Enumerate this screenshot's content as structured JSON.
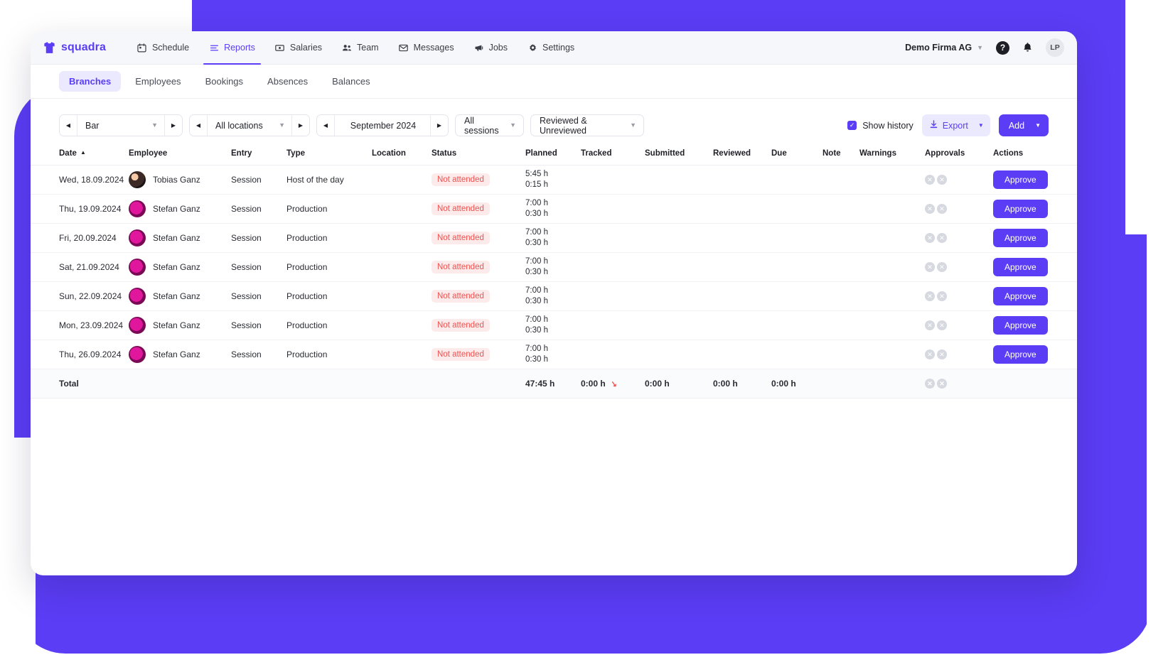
{
  "brand": {
    "name": "squadra",
    "icon": "tshirt-icon"
  },
  "topnav": {
    "items": [
      {
        "label": "Schedule",
        "icon": "calendar-icon",
        "active": false
      },
      {
        "label": "Reports",
        "icon": "list-icon",
        "active": true
      },
      {
        "label": "Salaries",
        "icon": "money-icon",
        "active": false
      },
      {
        "label": "Team",
        "icon": "people-icon",
        "active": false
      },
      {
        "label": "Messages",
        "icon": "envelope-icon",
        "active": false
      },
      {
        "label": "Jobs",
        "icon": "megaphone-icon",
        "active": false
      },
      {
        "label": "Settings",
        "icon": "gear-icon",
        "active": false
      }
    ],
    "company": "Demo Firma AG",
    "help_icon": "question-mark-icon",
    "bell_icon": "bell-icon",
    "avatar_initials": "LP"
  },
  "subtabs": [
    {
      "label": "Branches",
      "active": true
    },
    {
      "label": "Employees",
      "active": false
    },
    {
      "label": "Bookings",
      "active": false
    },
    {
      "label": "Absences",
      "active": false
    },
    {
      "label": "Balances",
      "active": false
    }
  ],
  "toolbar": {
    "branch_value": "Bar",
    "location_value": "All locations",
    "month_value": "September 2024",
    "sessions_value": "All sessions",
    "review_value": "Reviewed & Unreviewed",
    "show_history_label": "Show history",
    "show_history_checked": true,
    "export_label": "Export",
    "export_icon": "download-icon",
    "add_label": "Add"
  },
  "table": {
    "columns": [
      "Date",
      "Employee",
      "Entry",
      "Type",
      "Location",
      "Status",
      "Planned",
      "Tracked",
      "Submitted",
      "Reviewed",
      "Due",
      "Note",
      "Warnings",
      "Approvals",
      "Actions"
    ],
    "sort_column": "Date",
    "sort_direction": "asc",
    "rows": [
      {
        "date": "Wed, 18.09.2024",
        "employee": "Tobias Ganz",
        "avatar": "av-a",
        "entry": "Session",
        "type": "Host of the day",
        "location": "",
        "status": "Not attended",
        "planned_a": "5:45 h",
        "planned_b": "0:15 h",
        "tracked": "",
        "submitted": "",
        "reviewed": "",
        "due": "",
        "note": "",
        "warnings": "",
        "action": "Approve"
      },
      {
        "date": "Thu, 19.09.2024",
        "employee": "Stefan Ganz",
        "avatar": "av-b",
        "entry": "Session",
        "type": "Production",
        "location": "",
        "status": "Not attended",
        "planned_a": "7:00 h",
        "planned_b": "0:30 h",
        "tracked": "",
        "submitted": "",
        "reviewed": "",
        "due": "",
        "note": "",
        "warnings": "",
        "action": "Approve"
      },
      {
        "date": "Fri, 20.09.2024",
        "employee": "Stefan Ganz",
        "avatar": "av-b",
        "entry": "Session",
        "type": "Production",
        "location": "",
        "status": "Not attended",
        "planned_a": "7:00 h",
        "planned_b": "0:30 h",
        "tracked": "",
        "submitted": "",
        "reviewed": "",
        "due": "",
        "note": "",
        "warnings": "",
        "action": "Approve"
      },
      {
        "date": "Sat, 21.09.2024",
        "employee": "Stefan Ganz",
        "avatar": "av-b",
        "entry": "Session",
        "type": "Production",
        "location": "",
        "status": "Not attended",
        "planned_a": "7:00 h",
        "planned_b": "0:30 h",
        "tracked": "",
        "submitted": "",
        "reviewed": "",
        "due": "",
        "note": "",
        "warnings": "",
        "action": "Approve"
      },
      {
        "date": "Sun, 22.09.2024",
        "employee": "Stefan Ganz",
        "avatar": "av-b",
        "entry": "Session",
        "type": "Production",
        "location": "",
        "status": "Not attended",
        "planned_a": "7:00 h",
        "planned_b": "0:30 h",
        "tracked": "",
        "submitted": "",
        "reviewed": "",
        "due": "",
        "note": "",
        "warnings": "",
        "action": "Approve"
      },
      {
        "date": "Mon, 23.09.2024",
        "employee": "Stefan Ganz",
        "avatar": "av-b",
        "entry": "Session",
        "type": "Production",
        "location": "",
        "status": "Not attended",
        "planned_a": "7:00 h",
        "planned_b": "0:30 h",
        "tracked": "",
        "submitted": "",
        "reviewed": "",
        "due": "",
        "note": "",
        "warnings": "",
        "action": "Approve"
      },
      {
        "date": "Thu, 26.09.2024",
        "employee": "Stefan Ganz",
        "avatar": "av-b",
        "entry": "Session",
        "type": "Production",
        "location": "",
        "status": "Not attended",
        "planned_a": "7:00 h",
        "planned_b": "0:30 h",
        "tracked": "",
        "submitted": "",
        "reviewed": "",
        "due": "",
        "note": "",
        "warnings": "",
        "action": "Approve"
      }
    ],
    "total": {
      "label": "Total",
      "planned": "47:45 h",
      "tracked": "0:00 h",
      "submitted": "0:00 h",
      "reviewed": "0:00 h",
      "due": "0:00 h"
    }
  },
  "colors": {
    "accent": "#5b3df5",
    "accent_soft": "#ebe9fe",
    "danger": "#ef5350",
    "danger_soft": "#fdeaea",
    "page_bg": "#ffffff"
  }
}
